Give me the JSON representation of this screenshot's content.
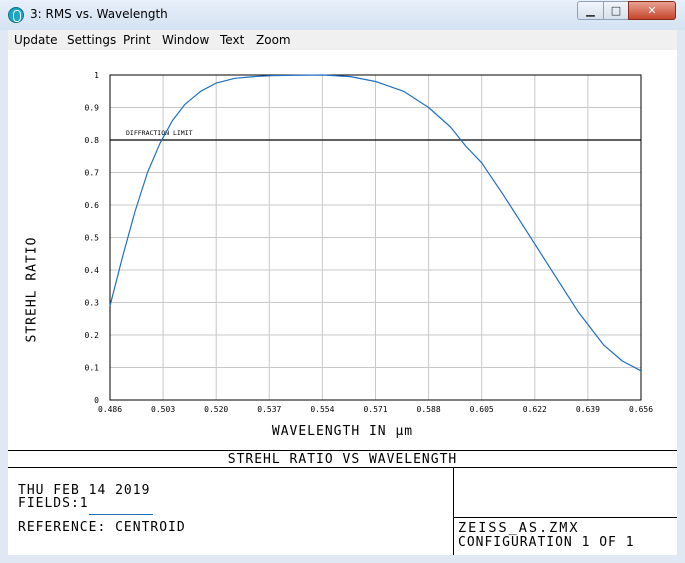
{
  "window": {
    "title": "3: RMS vs. Wavelength",
    "app_icon": "zemax-icon",
    "controls": {
      "minimize": "▁",
      "maximize": "□",
      "close": "✕"
    }
  },
  "menu": [
    "Update",
    "Settings",
    "Print",
    "Window",
    "Text",
    "Zoom"
  ],
  "plot": {
    "ylabel": "STREHL RATIO",
    "xlabel": "WAVELENGTH IN μm",
    "subtitle": "STREHL RATIO VS WAVELENGTH",
    "diffraction_label": "DIFFRACTION LIMIT"
  },
  "info": {
    "date": "THU FEB 14 2019",
    "fields": "FIELDS:1",
    "reference": "REFERENCE: CENTROID",
    "file": "ZEISS_AS.ZMX",
    "configuration": "CONFIGURATION 1 OF 1"
  },
  "chart_data": {
    "type": "line",
    "xlabel": "WAVELENGTH IN μm",
    "ylabel": "STREHL RATIO",
    "xlim": [
      0.486,
      0.656
    ],
    "ylim": [
      0,
      1
    ],
    "x_ticks": [
      "0.486",
      "0.503",
      "0.520",
      "0.537",
      "0.554",
      "0.571",
      "0.588",
      "0.605",
      "0.622",
      "0.639",
      "0.656"
    ],
    "y_ticks": [
      "0",
      "0.1",
      "0.2",
      "0.3",
      "0.4",
      "0.5",
      "0.6",
      "0.7",
      "0.8",
      "0.9",
      "1"
    ],
    "grid": true,
    "reference_line": {
      "label": "DIFFRACTION LIMIT",
      "y": 0.8
    },
    "series": [
      {
        "color": "#1f6fc4",
        "x": [
          0.486,
          0.49,
          0.494,
          0.498,
          0.502,
          0.506,
          0.51,
          0.515,
          0.52,
          0.526,
          0.532,
          0.538,
          0.545,
          0.554,
          0.563,
          0.571,
          0.58,
          0.588,
          0.595,
          0.6,
          0.605,
          0.612,
          0.62,
          0.628,
          0.636,
          0.644,
          0.65,
          0.656
        ],
        "y": [
          0.29,
          0.44,
          0.58,
          0.7,
          0.79,
          0.86,
          0.91,
          0.95,
          0.975,
          0.99,
          0.995,
          0.998,
          0.999,
          1.0,
          0.995,
          0.98,
          0.95,
          0.9,
          0.84,
          0.78,
          0.73,
          0.63,
          0.51,
          0.39,
          0.27,
          0.17,
          0.12,
          0.09
        ]
      }
    ]
  }
}
